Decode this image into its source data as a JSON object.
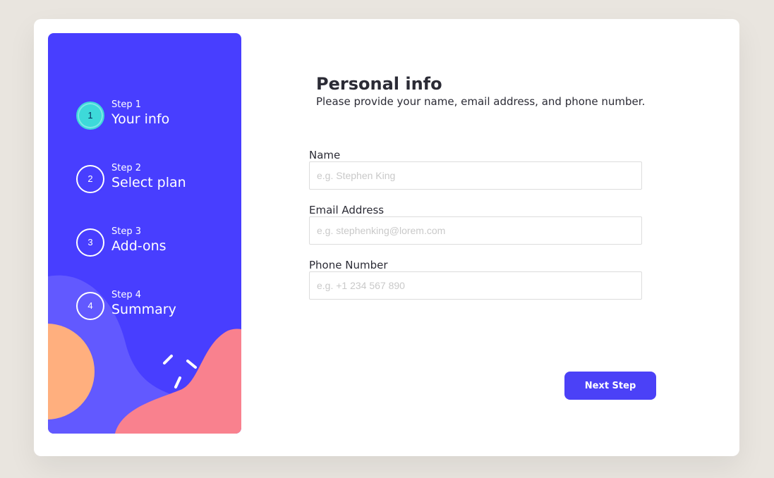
{
  "sidebar": {
    "steps": [
      {
        "number": "1",
        "label": "Step 1",
        "title": "Your info",
        "active": true
      },
      {
        "number": "2",
        "label": "Step 2",
        "title": "Select plan",
        "active": false
      },
      {
        "number": "3",
        "label": "Step 3",
        "title": "Add-ons",
        "active": false
      },
      {
        "number": "4",
        "label": "Step 4",
        "title": "Summary",
        "active": false
      }
    ]
  },
  "main": {
    "title": "Personal info",
    "subtitle": "Please provide your name, email address, and phone number.",
    "fields": [
      {
        "label": "Name",
        "value": "",
        "placeholder": "e.g. Stephen King"
      },
      {
        "label": "Email Address",
        "value": "",
        "placeholder": "e.g. stephenking@lorem.com"
      },
      {
        "label": "Phone Number",
        "value": "",
        "placeholder": "e.g. +1 234 567 890"
      }
    ],
    "next_button_label": "Next Step"
  },
  "colors": {
    "page_background": "#e9e5df",
    "sidebar_background": "#483eff",
    "active_step": "#3dd9d9",
    "button": "#4b41f7",
    "deco_purple": "#6259ff",
    "deco_orange": "#ffaf7e",
    "deco_pink": "#f9818e"
  }
}
